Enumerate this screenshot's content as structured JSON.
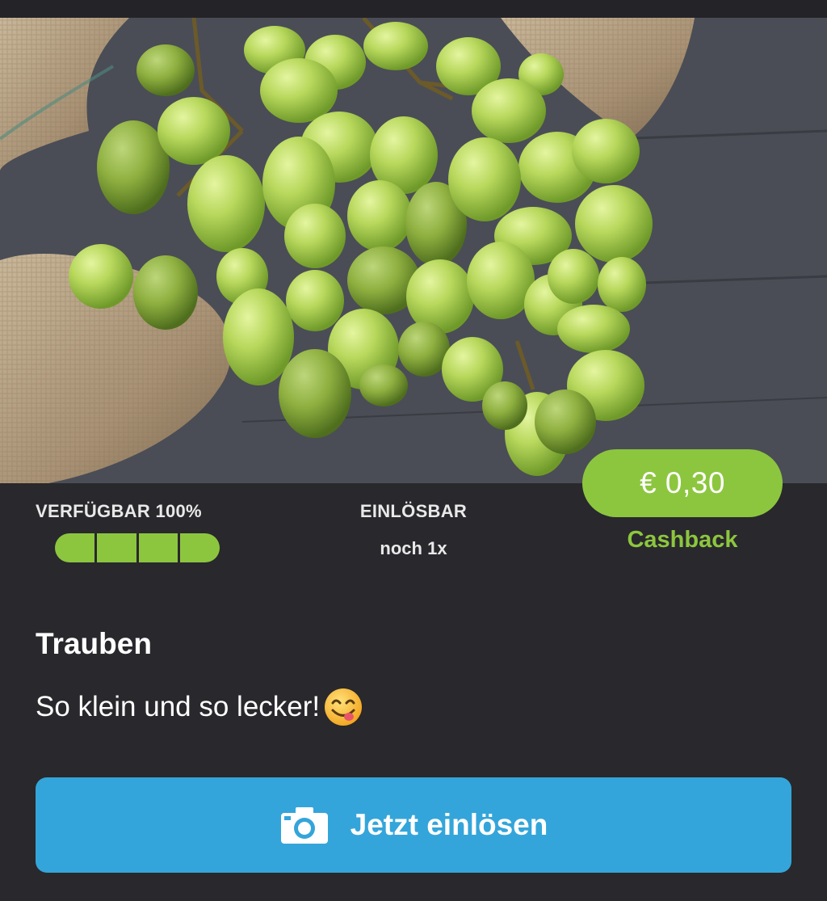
{
  "colors": {
    "background": "#29282c",
    "accent_green": "#8cc63f",
    "button_blue": "#34a5da",
    "text_light": "#e9e9ea"
  },
  "hero": {
    "image_subject": "green grapes on burlap and wooden table",
    "icon": "photo-grapes"
  },
  "cashback": {
    "amount": "€ 0,30",
    "label": "Cashback"
  },
  "availability": {
    "label": "VERFÜGBAR 100%",
    "level": 1.0,
    "segments": 4
  },
  "redeemable": {
    "label": "EINLÖSBAR",
    "count": "noch 1x"
  },
  "product": {
    "title": "Trauben",
    "description": "So klein und so lecker!",
    "emoji_icon": "face-savoring-food-icon"
  },
  "cta": {
    "label": "Jetzt einlösen",
    "icon": "camera-icon"
  }
}
